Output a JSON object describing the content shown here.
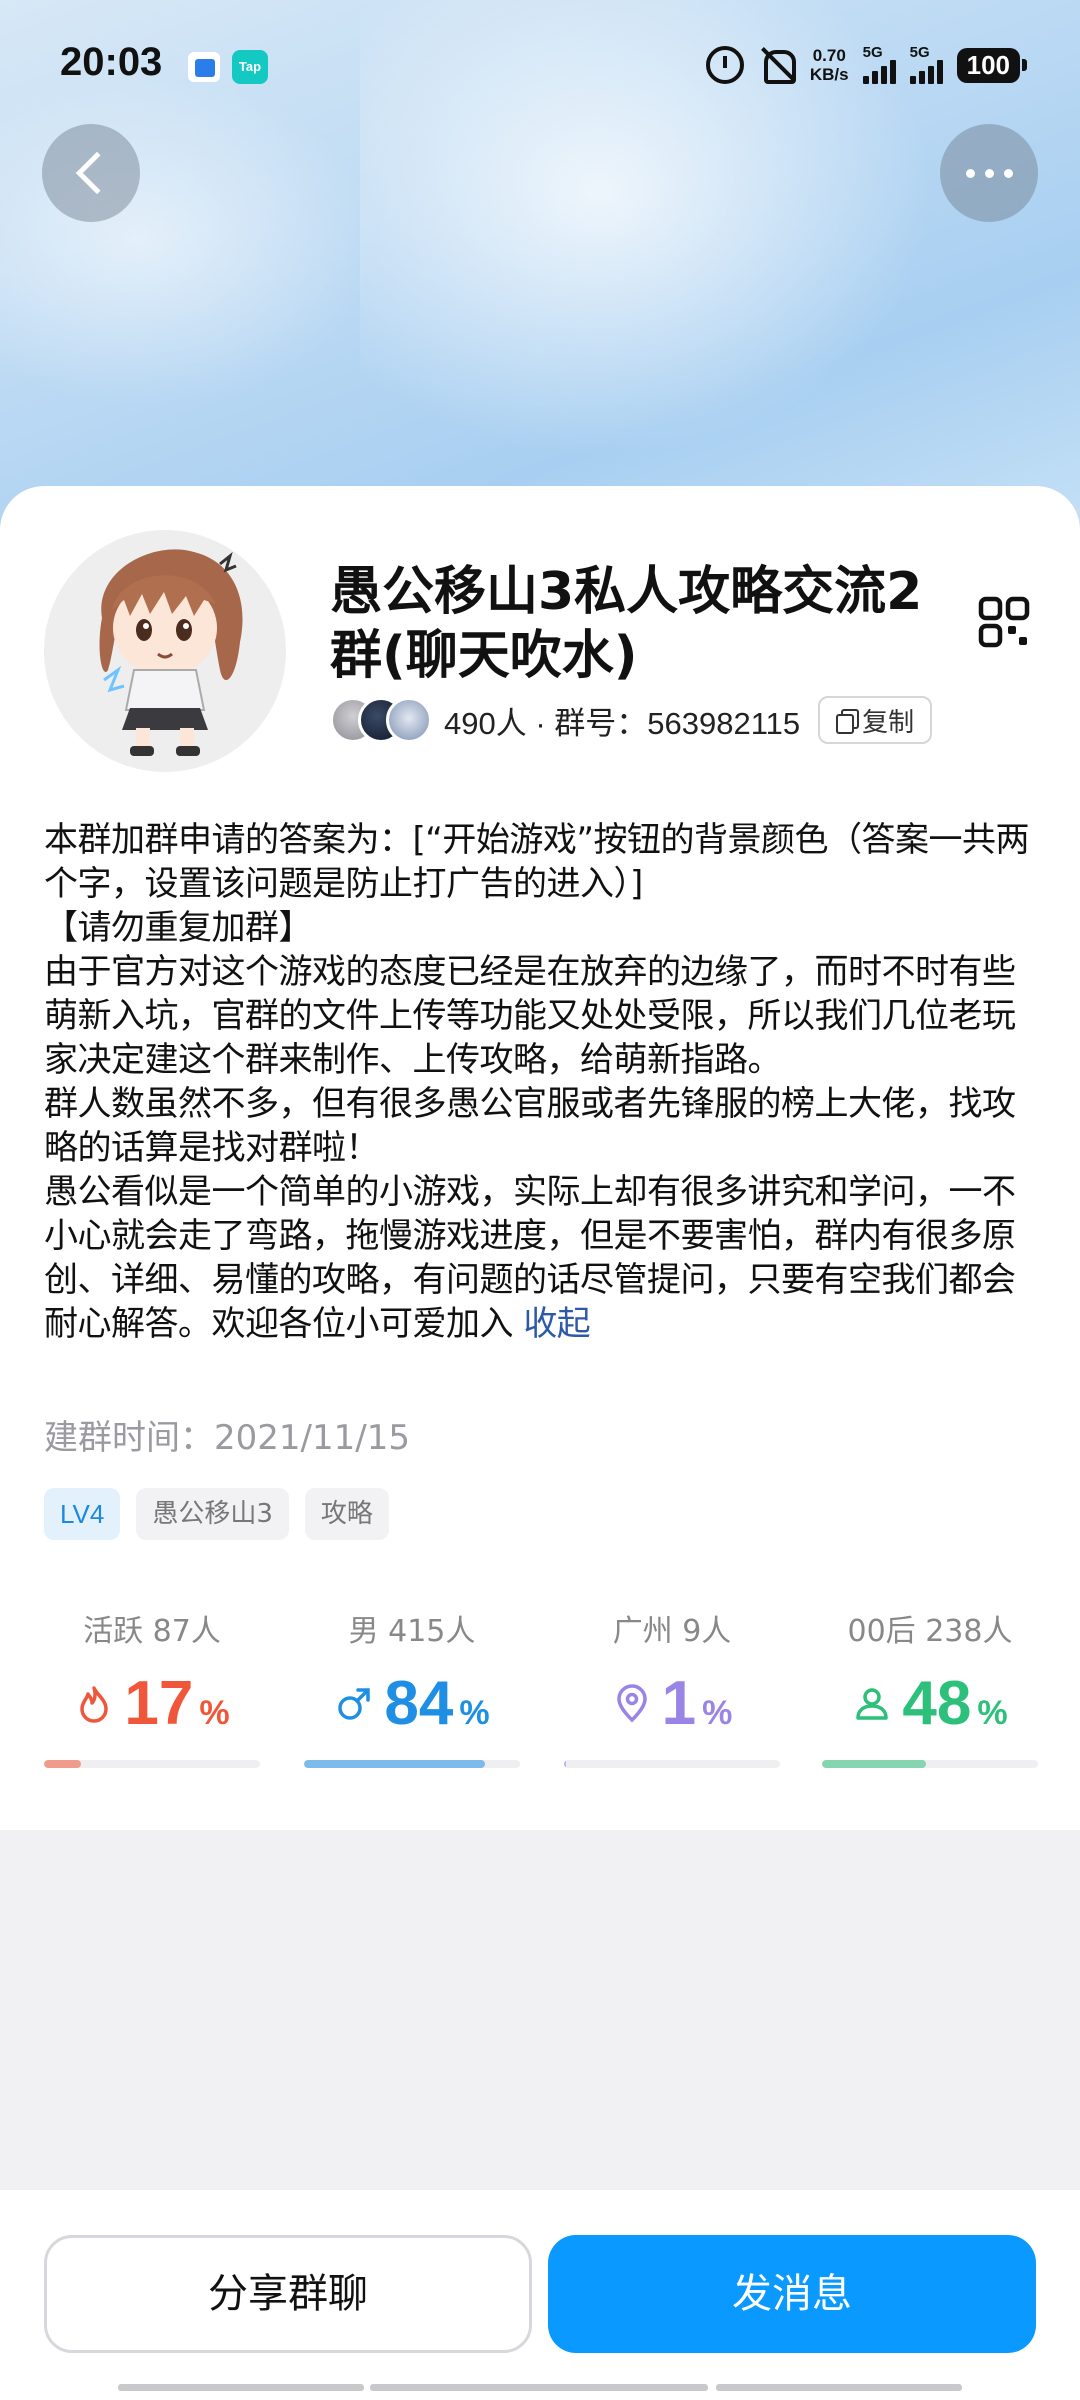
{
  "status_bar": {
    "time": "20:03",
    "app_icon_label": "Tap",
    "net_speed_value": "0.70",
    "net_speed_unit": "KB/s",
    "signal1": "5G",
    "signal2": "5G",
    "battery": "100"
  },
  "header": {
    "group_name": "愚公移山3私人攻略交流2群(聊天吹水)",
    "member_count_and_id": "490人 · 群号：563982115",
    "copy_label": "复制"
  },
  "intro": {
    "paragraphs": [
      "本群加群申请的答案为：[“开始游戏”按钮的背景颜色（答案一共两个字，设置该问题是防止打广告的进入）]",
      "【请勿重复加群】",
      "由于官方对这个游戏的态度已经是在放弃的边缘了，而时不时有些萌新入坑，官群的文件上传等功能又处处受限，所以我们几位老玩家决定建这个群来制作、上传攻略，给萌新指路。",
      "群人数虽然不多，但有很多愚公官服或者先锋服的榜上大佬，找攻略的话算是找对群啦！",
      "愚公看似是一个简单的小游戏，实际上却有很多讲究和学问，一不小心就会走了弯路，拖慢游戏进度，但是不要害怕，群内有很多原创、详细、易懂的攻略，有问题的话尽管提问，只要有空我们都会耐心解答。欢迎各位小可爱加入"
    ],
    "collapse_label": "收起"
  },
  "created": "建群时间：2021/11/15",
  "tags": [
    "LV4",
    "愚公移山3",
    "攻略"
  ],
  "stats": [
    {
      "label": "活跃 87人",
      "value": "17",
      "unit": "%",
      "fraction": 0.17,
      "color": "#f0573a",
      "icon": "flame-icon"
    },
    {
      "label": "男 415人",
      "value": "84",
      "unit": "%",
      "fraction": 0.84,
      "color": "#1f8fe5",
      "icon": "male-icon"
    },
    {
      "label": "广州 9人",
      "value": "1",
      "unit": "%",
      "fraction": 0.01,
      "color": "#9a84e6",
      "icon": "location-pin-icon"
    },
    {
      "label": "00后 238人",
      "value": "48",
      "unit": "%",
      "fraction": 0.48,
      "color": "#2cc07a",
      "icon": "person-icon"
    }
  ],
  "bottom": {
    "share_label": "分享群聊",
    "send_label": "发消息"
  }
}
